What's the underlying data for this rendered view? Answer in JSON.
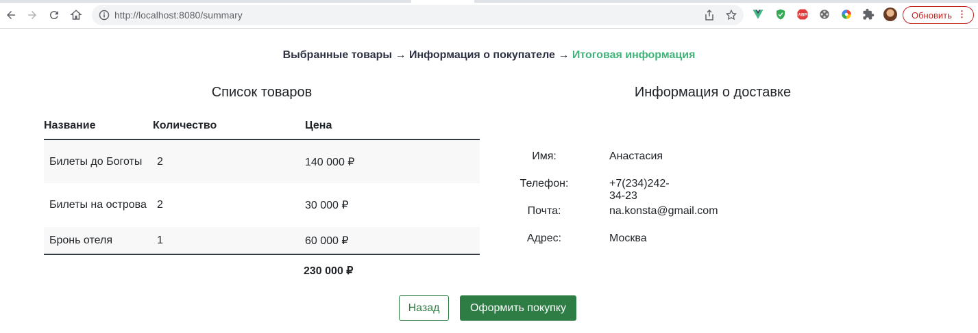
{
  "browser": {
    "url_host": "http://localhost",
    "url_rest": ":8080/summary",
    "update_label": "Обновить",
    "icons": [
      "back-icon",
      "forward-icon",
      "reload-icon",
      "home-icon",
      "info-icon",
      "share-icon",
      "star-icon",
      "vue-devtools-icon",
      "shield-extension-icon",
      "adblock-icon",
      "film-extension-icon",
      "color-wheel-icon",
      "puzzle-extensions-icon"
    ]
  },
  "steps": {
    "step1": "Выбранные товары",
    "arrow": " → ",
    "step2": "Информация о покупателе",
    "step3": "Итоговая информация"
  },
  "goods": {
    "title": "Список товаров",
    "headers": {
      "name": "Название",
      "qty": "Количество",
      "price": "Цена"
    },
    "rows": [
      {
        "name": "Билеты до Боготы",
        "qty": "2",
        "price": "140 000 ₽"
      },
      {
        "name": "Билеты на острова",
        "qty": "2",
        "price": "30 000 ₽"
      },
      {
        "name": "Бронь отеля",
        "qty": "1",
        "price": "60 000 ₽"
      }
    ],
    "total": "230 000 ₽"
  },
  "delivery": {
    "title": "Информация о доставке",
    "fields": [
      {
        "label": "Имя:",
        "value": "Анастасия"
      },
      {
        "label": "Телефон:",
        "value": "+7(234)242-34-23"
      },
      {
        "label": "Почта:",
        "value": "na.konsta@gmail.com"
      },
      {
        "label": "Адрес:",
        "value": "Москва"
      }
    ]
  },
  "buttons": {
    "back": "Назад",
    "buy": "Оформить покупку"
  },
  "colors": {
    "accent": "#41b37a",
    "button": "#2e7d45",
    "update": "#c5221f"
  }
}
